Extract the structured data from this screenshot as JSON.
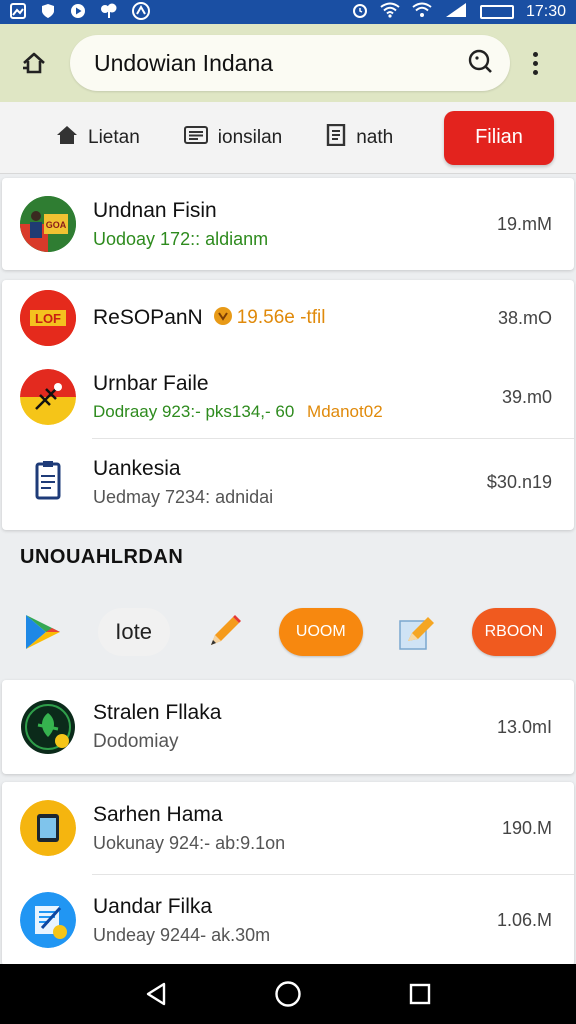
{
  "status_bar": {
    "time": "17:30",
    "icons": [
      "image-icon",
      "shield-icon",
      "play-icon",
      "tree-icon",
      "app-icon",
      "alarm-icon",
      "wifi-icon",
      "wifi-icon",
      "signal-icon",
      "battery-icon"
    ]
  },
  "app_bar": {
    "search_value": "Undowian Indana"
  },
  "tabs": [
    {
      "label": "Lietan",
      "icon": "house-icon"
    },
    {
      "label": "ionsilan",
      "icon": "list-icon"
    },
    {
      "label": "nath",
      "icon": "document-icon"
    },
    {
      "label": "Filian",
      "active": true
    }
  ],
  "card1": {
    "title": "Undnan Fisin",
    "subtitle": "Uodoay 172:: aldianm",
    "size": "19.mM"
  },
  "card2": {
    "items": [
      {
        "title": "ReSOPanN",
        "extra": "19.56e -tfil",
        "size": "38.mO"
      },
      {
        "title": "Urnbar Faile",
        "subtitle": "Dodraay 923:- pks134,- 60",
        "subtitle_extra": "Mdanot02",
        "size": "39.m0"
      },
      {
        "title": "Uankesia",
        "subtitle": "Uedmay 7234: adnidai",
        "size": "$30.n19"
      }
    ]
  },
  "section": {
    "heading": "UNOUAHLRDAN",
    "chips": [
      {
        "kind": "icon",
        "icon": "play-store-icon"
      },
      {
        "kind": "text",
        "label": "Iote"
      },
      {
        "kind": "icon",
        "icon": "pencil-icon"
      },
      {
        "kind": "pill",
        "label": "UOOM"
      },
      {
        "kind": "icon",
        "icon": "edit-note-icon"
      },
      {
        "kind": "pill",
        "label": "RBOON"
      }
    ]
  },
  "card3": {
    "title": "Stralen Fllaka",
    "subtitle": "Dodomiay",
    "size": "13.0mI"
  },
  "card4": {
    "items": [
      {
        "title": "Sarhen Hama",
        "subtitle": "Uokunay 924:- ab:9.1on",
        "size": "190.M"
      },
      {
        "title": "Uandar Filka",
        "subtitle": "Undeay 9244- ak.30m",
        "size": "1.06.M"
      }
    ]
  },
  "colors": {
    "status_bar": "#1a4fa3",
    "app_bar": "#dfe6c4",
    "active_tab": "#e3231e",
    "accent_orange": "#f7880f",
    "green_text": "#2e8b1e"
  }
}
